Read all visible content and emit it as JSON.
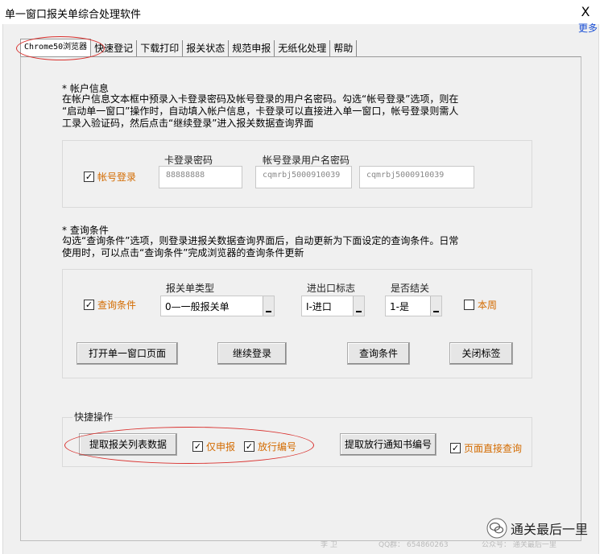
{
  "window": {
    "title": "单一窗口报关单综合处理软件",
    "close": "X",
    "more": "更多"
  },
  "tabs": [
    "Chrome50浏览器",
    "快速登记",
    "下载打印",
    "报关状态",
    "规范申报",
    "无纸化处理",
    "帮助"
  ],
  "account": {
    "section_title": "* 帐户信息",
    "description": [
      "在帐户信息文本框中预录入卡登录密码及帐号登录的用户名密码。勾选“帐号登录”选项，则在",
      "“启动单一窗口”操作时，自动填入帐户信息，卡登录可以直接进入单一窗口，帐号登录则需人",
      "工录入验证码，然后点击“继续登录”进入报关数据查询界面"
    ],
    "checkbox_label": "帐号登录",
    "card_pwd_label": "卡登录密码",
    "account_label": "帐号登录用户名密码",
    "card_pwd_value": "88888888",
    "username_value": "cqmrbj5000910039",
    "password_value": "cqmrbj5000910039"
  },
  "query": {
    "section_title": "* 查询条件",
    "description": [
      "勾选“查询条件”选项，则登录进报关数据查询界面后，自动更新为下面设定的查询条件。日常",
      "使用时，可以点击“查询条件”完成浏览器的查询条件更新"
    ],
    "checkbox_label": "查询条件",
    "type_label": "报关单类型",
    "type_value": "0—一般报关单",
    "ie_label": "进出口标志",
    "ie_value": "I-进口",
    "closed_label": "是否结关",
    "closed_value": "1-是",
    "week_label": "本周",
    "buttons": [
      "打开单一窗口页面",
      "继续登录",
      "查询条件",
      "关闭标签"
    ]
  },
  "shortcuts": {
    "group_label": "快捷操作",
    "fetch_list": "提取报关列表数据",
    "only_declare": "仅申报",
    "release_no": "放行编号",
    "fetch_notice": "提取放行通知书编号",
    "direct_query": "页面直接查询"
  },
  "footer": {
    "qq": "QQ群： 654860263",
    "left": "李 卫",
    "public": "公众号： 通关最后一里"
  },
  "watermark": "通关最后一里",
  "colors": {
    "accent_orange": "#d36b00",
    "annotation_red": "#d9302d",
    "link_blue": "#1a4fd6"
  }
}
